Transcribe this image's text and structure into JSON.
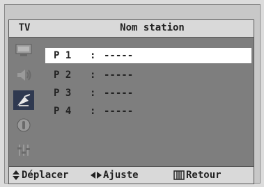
{
  "header": {
    "tv_label": "TV",
    "title": "Nom station"
  },
  "sidebar": {
    "icons": [
      "picture-icon",
      "sound-icon",
      "channel-icon",
      "timer-icon",
      "setup-icon"
    ],
    "active_index": 2
  },
  "stations": [
    {
      "label": "P 1",
      "sep": ":",
      "name": "-----",
      "selected": true
    },
    {
      "label": "P 2",
      "sep": ":",
      "name": "-----",
      "selected": false
    },
    {
      "label": "P 3",
      "sep": ":",
      "name": "-----",
      "selected": false
    },
    {
      "label": "P 4",
      "sep": ":",
      "name": "-----",
      "selected": false
    }
  ],
  "footer": {
    "move_label": "Déplacer",
    "adjust_label": "Ajuste",
    "back_label": "Retour"
  },
  "colors": {
    "osd_bg": "#7e7e7e",
    "bar_bg": "#d9d9d9",
    "active_icon_bg": "#2f3950",
    "selected_row": "#ffffff"
  }
}
